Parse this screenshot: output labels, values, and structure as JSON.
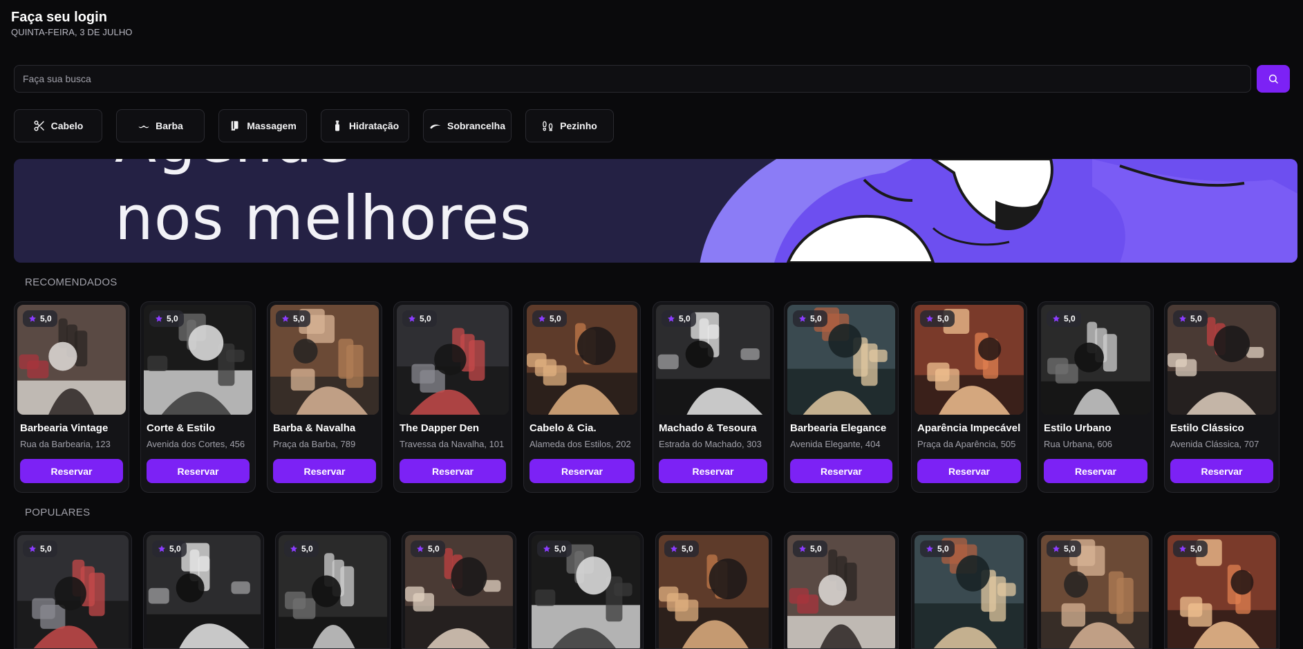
{
  "header": {
    "title": "Faça seu login",
    "date": "QUINTA-FEIRA, 3 DE JULHO"
  },
  "search": {
    "placeholder": "Faça sua busca",
    "button_icon": "search-icon"
  },
  "quick_search": [
    {
      "label": "Cabelo",
      "icon": "scissors-icon"
    },
    {
      "label": "Barba",
      "icon": "mustache-icon"
    },
    {
      "label": "Massagem",
      "icon": "towel-icon"
    },
    {
      "label": "Hidratação",
      "icon": "spray-bottle-icon"
    },
    {
      "label": "Sobrancelha",
      "icon": "eyebrow-icon"
    },
    {
      "label": "Pezinho",
      "icon": "footprints-icon"
    }
  ],
  "banner": {
    "text": "nos melhores",
    "partial_text": "Agende"
  },
  "colors": {
    "accent": "#7c22f5",
    "background": "#0a0a0c",
    "card": "#141417",
    "banner": "#242144"
  },
  "recommended": {
    "title": "RECOMENDADOS",
    "items": [
      {
        "name": "Barbearia Vintage",
        "address": "Rua da Barbearia, 123",
        "rating": "5,0",
        "button": "Reservar"
      },
      {
        "name": "Corte & Estilo",
        "address": "Avenida dos Cortes, 456",
        "rating": "5,0",
        "button": "Reservar"
      },
      {
        "name": "Barba & Navalha",
        "address": "Praça da Barba, 789",
        "rating": "5,0",
        "button": "Reservar"
      },
      {
        "name": "The Dapper Den",
        "address": "Travessa da Navalha, 101",
        "rating": "5,0",
        "button": "Reservar"
      },
      {
        "name": "Cabelo & Cia.",
        "address": "Alameda dos Estilos, 202",
        "rating": "5,0",
        "button": "Reservar"
      },
      {
        "name": "Machado & Tesoura",
        "address": "Estrada do Machado, 303",
        "rating": "5,0",
        "button": "Reservar"
      },
      {
        "name": "Barbearia Elegance",
        "address": "Avenida Elegante, 404",
        "rating": "5,0",
        "button": "Reservar"
      },
      {
        "name": "Aparência Impecável",
        "address": "Praça da Aparência, 505",
        "rating": "5,0",
        "button": "Reservar"
      },
      {
        "name": "Estilo Urbano",
        "address": "Rua Urbana, 606",
        "rating": "5,0",
        "button": "Reservar"
      },
      {
        "name": "Estilo Clássico",
        "address": "Avenida Clássica, 707",
        "rating": "5,0",
        "button": "Reservar"
      }
    ]
  },
  "popular": {
    "title": "POPULARES",
    "items": [
      {
        "rating": "5,0"
      },
      {
        "rating": "5,0"
      },
      {
        "rating": "5,0"
      },
      {
        "rating": "5,0"
      },
      {
        "rating": "5,0"
      },
      {
        "rating": "5,0"
      },
      {
        "rating": "5,0"
      },
      {
        "rating": "5,0"
      },
      {
        "rating": "5,0"
      },
      {
        "rating": "5,0"
      }
    ]
  }
}
